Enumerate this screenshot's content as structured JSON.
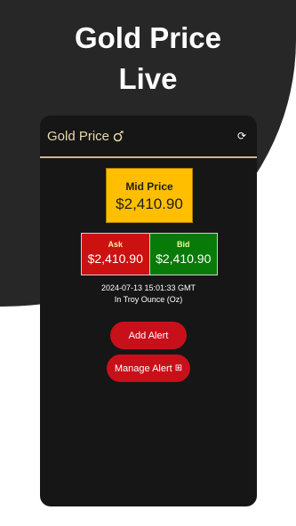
{
  "hero": {
    "line1": "Gold Price",
    "line2": "Live"
  },
  "appbar": {
    "title": "Gold Price",
    "ring_icon": "ring-icon",
    "refresh_icon": "refresh-icon",
    "refresh_glyph": "⟳"
  },
  "mid": {
    "label": "Mid Price",
    "value": "$2,410.90"
  },
  "ask": {
    "label": "Ask",
    "value": "$2,410.90"
  },
  "bid": {
    "label": "Bid",
    "value": "$2,410.90"
  },
  "timestamp": "2024-07-13 15:01:33 GMT",
  "unit": "In Troy Ounce (Oz)",
  "buttons": {
    "add_alert": "Add Alert",
    "manage_alert": "Manage Alert",
    "manage_icon": "⊞"
  },
  "colors": {
    "gold": "#ffbf00",
    "ask_red": "#cc1111",
    "bid_green": "#087a08",
    "button_red": "#c8101a",
    "card_bg": "#161616"
  }
}
